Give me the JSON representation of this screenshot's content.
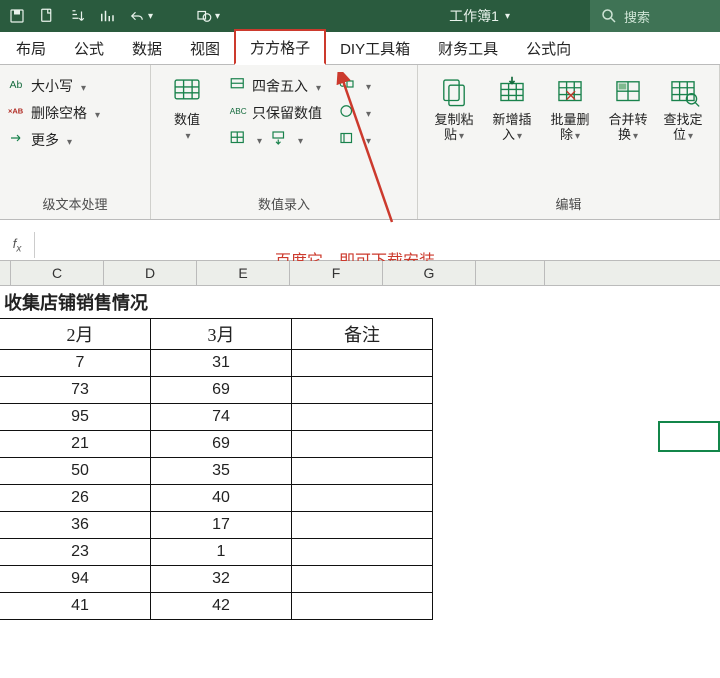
{
  "window": {
    "title": "工作簿1"
  },
  "search": {
    "placeholder": "搜索"
  },
  "tabs": [
    "布局",
    "公式",
    "数据",
    "视图",
    "方方格子",
    "DIY工具箱",
    "财务工具",
    "公式向"
  ],
  "active_tab_index": 4,
  "ribbon": {
    "textGroup": {
      "case": "大小写",
      "delspace": "删除空格",
      "more": "更多",
      "label": "级文本处理"
    },
    "numGroup": {
      "numBig": "数值",
      "round": "四舍五入",
      "keep": "只保留数值",
      "label": "数值录入"
    },
    "editGroup": {
      "copy": "复制粘贴",
      "insert": "新增插入",
      "del": "批量删除",
      "merge": "合并转换",
      "find": "查找定位",
      "label": "编辑"
    }
  },
  "annotation": "百度它，即可下载安装",
  "columns": [
    "C",
    "D",
    "E",
    "F",
    "G"
  ],
  "sheet": {
    "title": "收集店铺销售情况",
    "headers": [
      "2月",
      "3月",
      "备注"
    ],
    "rows": [
      {
        "c": "7",
        "d": "31"
      },
      {
        "c": "73",
        "d": "69"
      },
      {
        "c": "95",
        "d": "74"
      },
      {
        "c": "21",
        "d": "69"
      },
      {
        "c": "50",
        "d": "35"
      },
      {
        "c": "26",
        "d": "40"
      },
      {
        "c": "36",
        "d": "17"
      },
      {
        "c": "23",
        "d": "1"
      },
      {
        "c": "94",
        "d": "32"
      },
      {
        "c": "41",
        "d": "42"
      }
    ]
  }
}
